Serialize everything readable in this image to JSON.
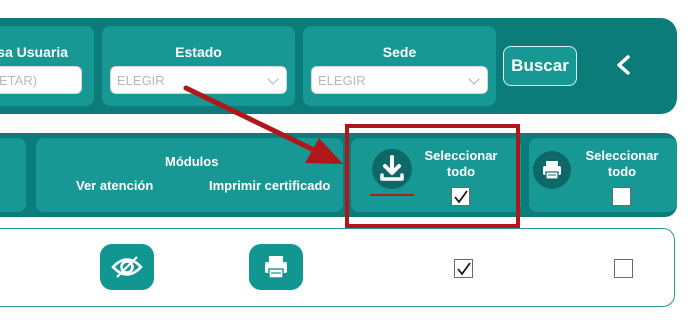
{
  "filters": {
    "usuaria": {
      "label": "sa Usuaria",
      "value": "ETAR)"
    },
    "estado": {
      "label": "Estado",
      "placeholder": "ELEGIR"
    },
    "sede": {
      "label": "Sede",
      "placeholder": "ELEGIR"
    },
    "search_label": "Buscar",
    "collapse_icon": "chevron-left-icon"
  },
  "modules_header": {
    "title": "Módulos",
    "ver_atencion": "Ver atención",
    "imprimir_certificado": "Imprimir certificado",
    "download_col": {
      "icon": "download-icon",
      "select_label_1": "Seleccionar",
      "select_label_2": "todo",
      "checked": true
    },
    "print_col": {
      "icon": "printer-icon",
      "select_label_1": "Seleccionar",
      "select_label_2": "todo",
      "checked": false
    }
  },
  "row": {
    "view_icon": "eye-icon",
    "print_icon": "printer-icon",
    "download_checked": true,
    "print_checked": false
  },
  "colors": {
    "dark_teal": "#0b7c7a",
    "cell_teal": "#179895",
    "button_teal": "#119692",
    "annotation_red": "#b0171a"
  }
}
